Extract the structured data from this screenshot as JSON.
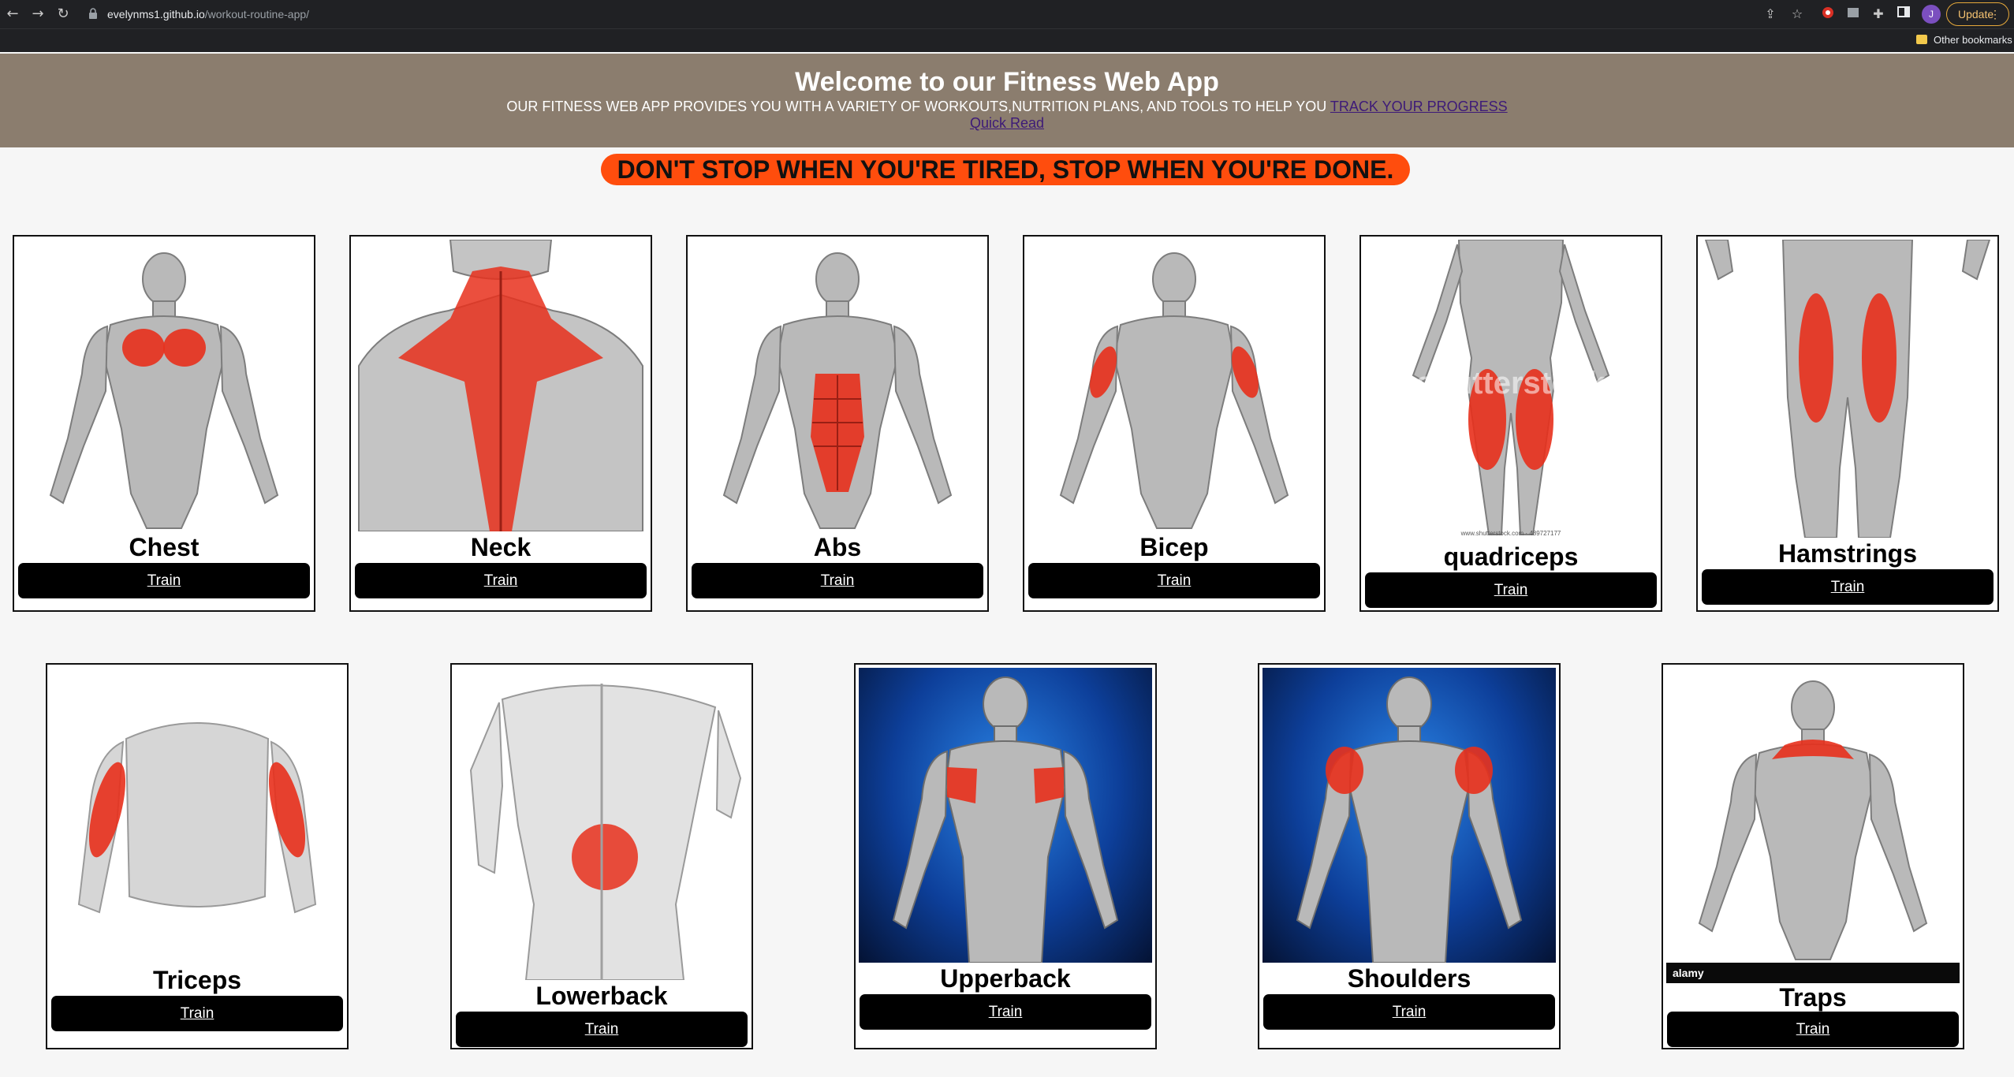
{
  "browser": {
    "url_host": "evelynms1.github.io",
    "url_path": "/workout-routine-app/",
    "profile_initial": "J",
    "update_label": "Update",
    "bookmark_folder": "Other bookmarks"
  },
  "header": {
    "title": "Welcome to our Fitness Web App",
    "tagline": "OUR FITNESS WEB APP PROVIDES YOU WITH A VARIETY OF WORKOUTS,NUTRITION PLANS, AND TOOLS TO HELP YOU ",
    "track_link": "TRACK YOUR PROGRESS",
    "quick_read_link": "Quick Read"
  },
  "motto": "DON'T STOP WHEN YOU'RE TIRED, STOP WHEN YOU'RE DONE.",
  "cards": [
    {
      "name": "Chest",
      "button": "Train"
    },
    {
      "name": "Neck",
      "button": "Train"
    },
    {
      "name": "Abs",
      "button": "Train"
    },
    {
      "name": "Bicep",
      "button": "Train"
    },
    {
      "name": "quadriceps",
      "button": "Train",
      "watermark": "shutterstock",
      "credit": "www.shutterstock.com · 489727177"
    },
    {
      "name": "Hamstrings",
      "button": "Train"
    },
    {
      "name": "Triceps",
      "button": "Train"
    },
    {
      "name": "Lowerback",
      "button": "Train"
    },
    {
      "name": "Upperback",
      "button": "Train"
    },
    {
      "name": "Shoulders",
      "button": "Train"
    },
    {
      "name": "Traps",
      "button": "Train",
      "watermark": "alamy"
    }
  ],
  "colors": {
    "header_bg": "#8b7d6e",
    "motto_bg": "#ff4d0d",
    "button_bg": "#000000",
    "muscle_highlight": "#e8301c"
  }
}
